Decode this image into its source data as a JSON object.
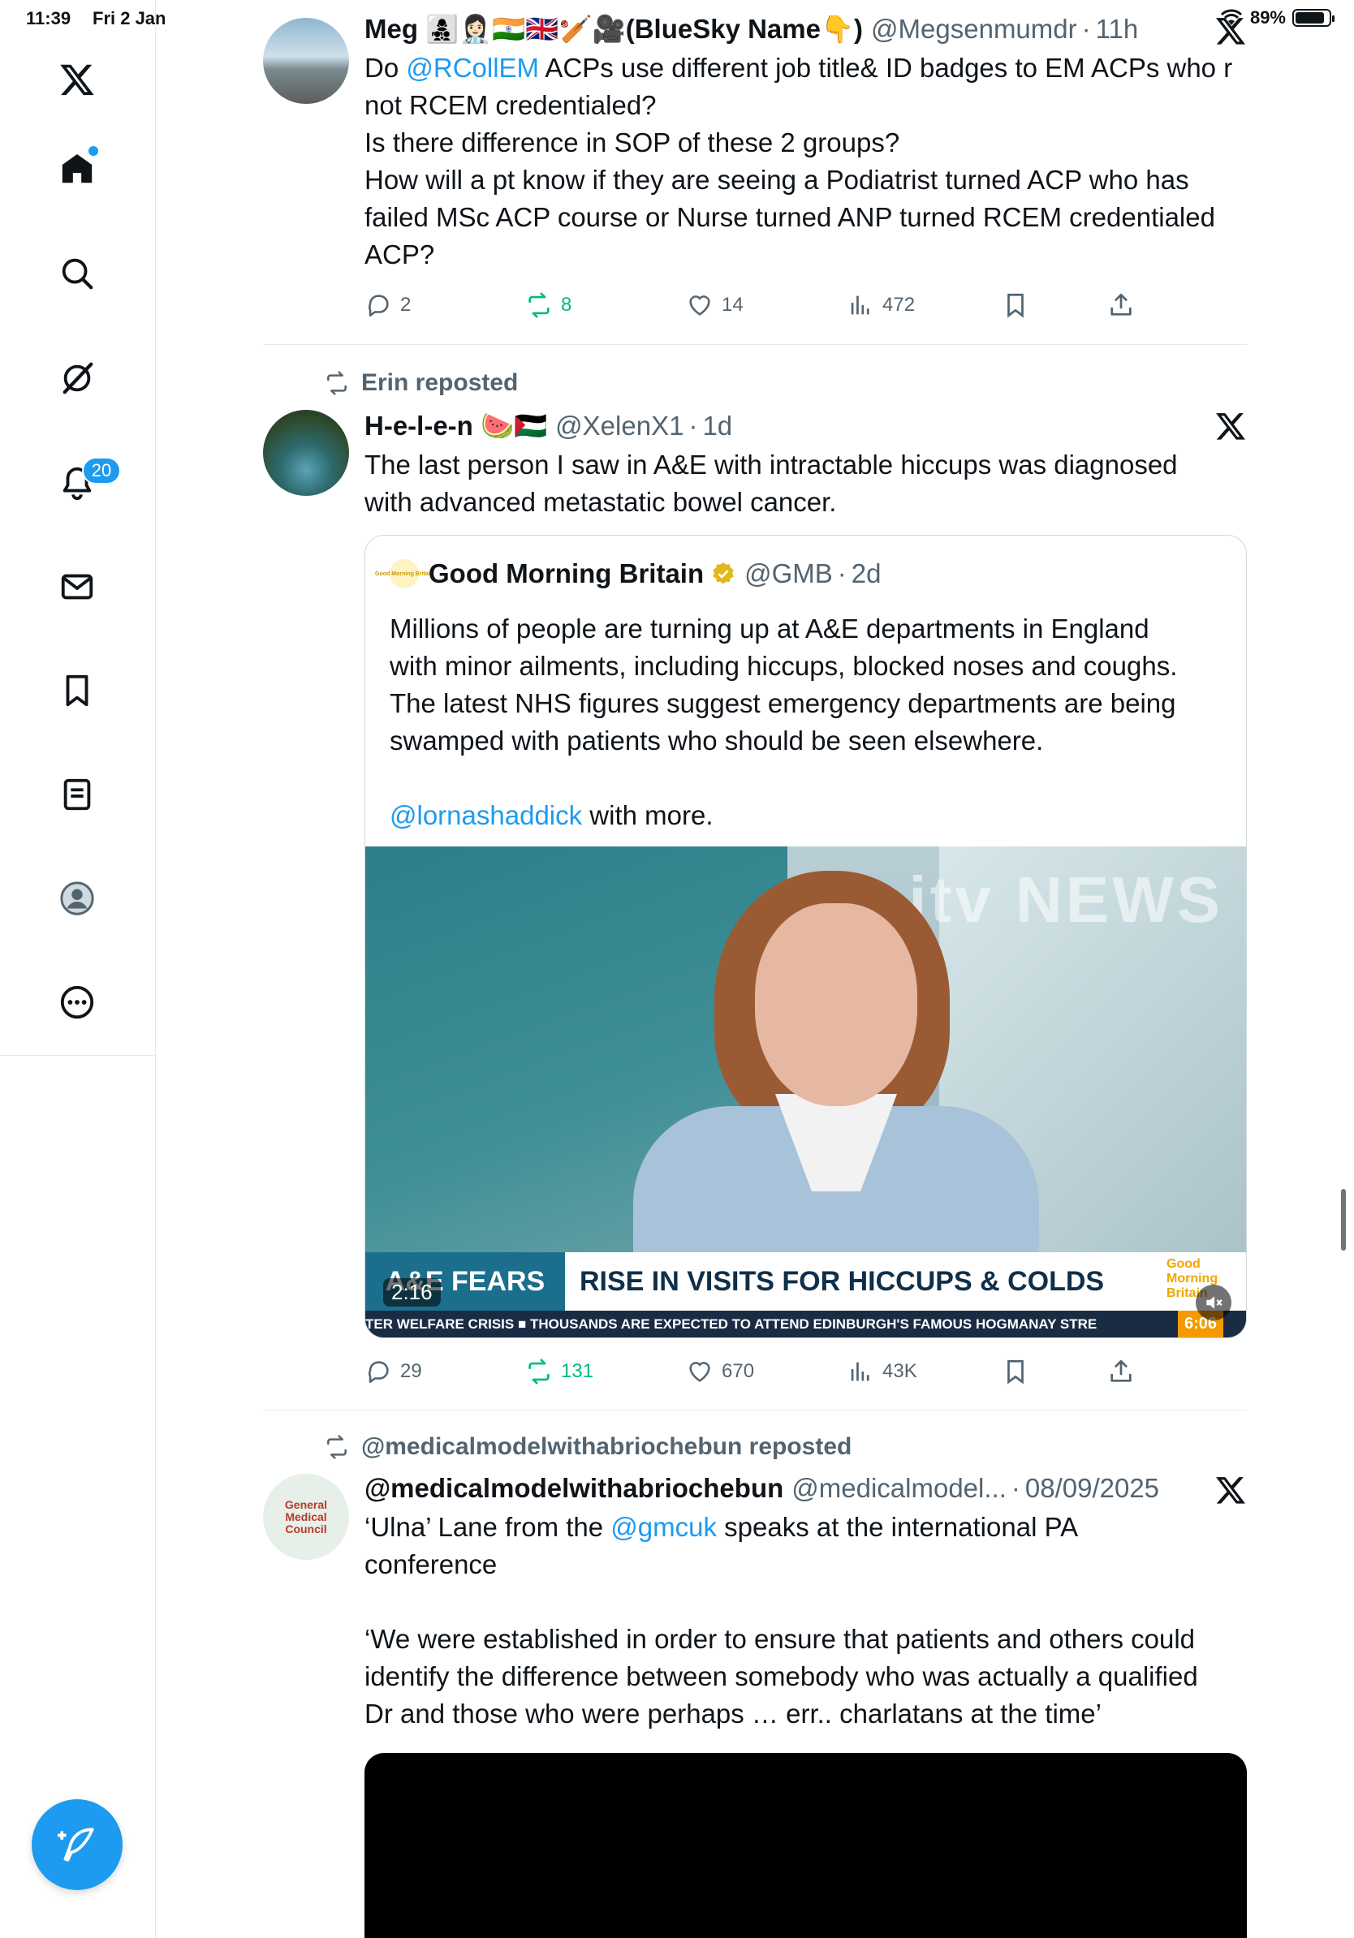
{
  "status_bar": {
    "time": "11:39",
    "date": "Fri 2 Jan",
    "battery": "89%"
  },
  "sidebar": {
    "items": [
      {
        "name": "X logo"
      },
      {
        "name": "Home"
      },
      {
        "name": "Explore"
      },
      {
        "name": "Grok"
      },
      {
        "name": "Notifications",
        "badge": "20"
      },
      {
        "name": "Messages"
      },
      {
        "name": "Bookmarks"
      },
      {
        "name": "Lists"
      },
      {
        "name": "Profile"
      },
      {
        "name": "More"
      }
    ]
  },
  "tweets": [
    {
      "name": "Meg 👩‍👧‍👦👩🏻‍⚕️🇮🇳🇬🇧🏏🎥(BlueSky Name👇)",
      "handle": "@Megsenmumdr",
      "time": "11h",
      "text_parts": [
        "Do ",
        "@RCollEM",
        " ACPs use different job title& ID badges to EM ACPs who r\nnot RCEM credentialed?\nIs there difference in SOP of these 2 groups?\nHow will a pt know if they are seeing a Podiatrist turned ACP who has\nfailed MSc ACP course or Nurse turned ANP turned RCEM credentialed\nACP?"
      ],
      "stats": {
        "replies": "2",
        "reposts": "8",
        "likes": "14",
        "views": "472"
      }
    },
    {
      "reposted_by": "Erin reposted",
      "name": "H-e-l-e-n 🍉🇵🇸",
      "handle": "@XelenX1",
      "time": "1d",
      "text": "The last person I saw in A&E with intractable hiccups was diagnosed\nwith advanced metastatic bowel cancer.",
      "quote": {
        "name": "Good Morning Britain",
        "handle": "@GMB",
        "time": "2d",
        "logo_text": "Good Morning Britain",
        "text": "Millions of people are turning up at A&E departments in England\nwith minor ailments, including hiccups, blocked noses and coughs.\nThe latest NHS figures suggest emergency departments are being\nswamped with patients who should be seen elsewhere.\n\n",
        "link": "@lornashaddick",
        "link_suffix": " with more.",
        "video": {
          "strap_left": "A&E FEARS",
          "strap_main": "RISE IN VISITS FOR HICCUPS & COLDS",
          "strap_logo": "Good Morning Britain",
          "ticker": "TER WELFARE CRISIS   ■   THOUSANDS ARE EXPECTED TO ATTEND EDINBURGH'S FAMOUS HOGMANAY STRE",
          "clock": "6:06",
          "duration": "2:16",
          "watermark": "itv NEWS"
        }
      },
      "stats": {
        "replies": "29",
        "reposts": "131",
        "likes": "670",
        "views": "43K"
      }
    },
    {
      "reposted_by": "@medicalmodelwithabriochebun reposted",
      "name": "@medicalmodelwithabriochebun",
      "handle": "@medicalmodel...",
      "time": "08/09/2025",
      "text_parts": [
        "‘Ulna’ Lane from the ",
        "@gmcuk",
        " speaks at the international PA\nconference\n\n‘We were established in order to ensure that patients and others could\nidentify the difference between somebody who was actually a qualified\nDr and those who were perhaps … err.. charlatans at the time’"
      ],
      "avatar_text": "General Medical Council"
    }
  ],
  "colors": {
    "accent": "#1d9bf0",
    "repost_green": "#00ba7c",
    "muted": "#536471",
    "border": "#e6e9ec"
  }
}
